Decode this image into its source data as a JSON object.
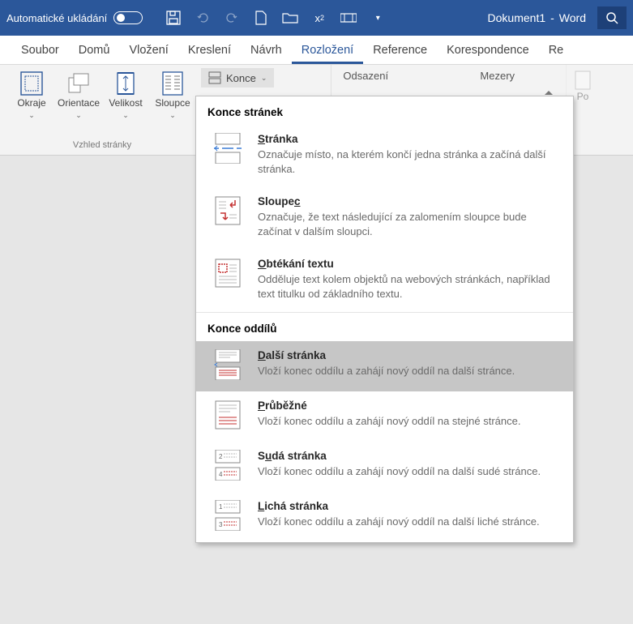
{
  "titlebar": {
    "autosave_label": "Automatické ukládání",
    "document_name": "Dokument1",
    "app_name": "Word",
    "sep": "-"
  },
  "tabs": {
    "soubor": "Soubor",
    "domu": "Domů",
    "vlozeni": "Vložení",
    "kresleni": "Kreslení",
    "navrh": "Návrh",
    "rozlozeni": "Rozložení",
    "reference": "Reference",
    "korespondence": "Korespondence",
    "re": "Re"
  },
  "ribbon": {
    "okraje": "Okraje",
    "orientace": "Orientace",
    "velikost": "Velikost",
    "sloupce": "Sloupce",
    "konce": "Konce",
    "group_caption": "Vzhled stránky",
    "odsazeni": "Odsazení",
    "mezery": "Mezery",
    "po": "Po"
  },
  "dropdown": {
    "section_page": "Konce stránek",
    "section_oddil": "Konce oddílů",
    "items": {
      "stranka": {
        "title_pre": "",
        "acc": "S",
        "title_post": "tránka",
        "desc": "Označuje místo, na kterém končí jedna stránka a začíná další stránka."
      },
      "sloupec": {
        "title_pre": "Sloupe",
        "acc": "c",
        "title_post": "",
        "desc": "Označuje, že text následující za zalomením sloupce bude začínat v dalším sloupci."
      },
      "obtekani": {
        "title_pre": "",
        "acc": "O",
        "title_post": "btékání textu",
        "desc": "Odděluje text kolem objektů na webových stránkách, například text titulku od základního textu."
      },
      "dalsi": {
        "title_pre": "",
        "acc": "D",
        "title_post": "alší stránka",
        "desc": "Vloží konec oddílu a zahájí nový oddíl na další stránce."
      },
      "prubezne": {
        "title_pre": "",
        "acc": "P",
        "title_post": "růběžné",
        "desc": "Vloží konec oddílu a zahájí nový oddíl na stejné stránce."
      },
      "suda": {
        "title_pre": "S",
        "acc": "u",
        "title_post": "dá stránka",
        "desc": "Vloží konec oddílu a zahájí nový oddíl na další sudé stránce."
      },
      "licha": {
        "title_pre": "",
        "acc": "L",
        "title_post": "ichá stránka",
        "desc": "Vloží konec oddílu a zahájí nový oddíl na další liché stránce."
      }
    }
  }
}
